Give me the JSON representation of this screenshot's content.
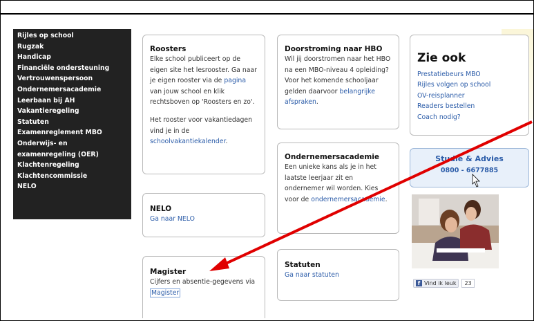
{
  "sidebar": {
    "items": [
      "Rijles op school",
      "Rugzak",
      "Handicap",
      "Financiële ondersteuning",
      "Vertrouwenspersoon",
      "Ondernemersacademie",
      "Leerbaan bij AH",
      "Vakantieregeling",
      "Statuten",
      "Examenreglement MBO",
      "Onderwijs- en",
      "examenregeling (OER)",
      "Klachtenregeling",
      "Klachtencommissie",
      "NELO"
    ]
  },
  "roosters": {
    "title": "Roosters",
    "text1": "Elke school publiceert op de eigen site het lesrooster. Ga naar je eigen rooster via de",
    "link1": "pagina",
    "text2": "van jouw school en klik rechtsboven op 'Roosters en zo'.",
    "text3": "Het rooster voor vakantiedagen vind je in de",
    "link2": "schoolvakantiekalender",
    "text4": "."
  },
  "nelo": {
    "title": "NELO",
    "link": "Ga naar NELO"
  },
  "magister": {
    "title": "Magister",
    "text": "Cijfers en absentie-gegevens via",
    "link": "Magister"
  },
  "doorstroming": {
    "title": "Doorstroming naar HBO",
    "text": "Wil jij doorstromen naar het HBO na een MBO-niveau 4 opleiding? Voor het komende schooljaar gelden daarvoor",
    "link": "belangrijke afspraken",
    "end": "."
  },
  "ondernemers": {
    "title": "Ondernemersacademie",
    "text": "Een unieke kans als je in het laatste leerjaar zit en ondernemer wil worden. Kies voor de",
    "link": "ondernemersacademie",
    "end": "."
  },
  "statuten": {
    "title": "Statuten",
    "link": "Ga naar statuten"
  },
  "zieook": {
    "title": "Zie ook",
    "links": [
      "Prestatiebeurs MBO",
      "Rijles volgen op school",
      "OV-reisplanner",
      "Readers bestellen",
      "Coach nodig?"
    ]
  },
  "studie": {
    "title": "Studie & Advies",
    "phone": "0800 - 6677885"
  },
  "facebook": {
    "like": "Vind ik leuk",
    "count": "23"
  },
  "colors": {
    "arrow": "#e00000",
    "link": "#2a5ba8",
    "sidebar": "#222222"
  }
}
